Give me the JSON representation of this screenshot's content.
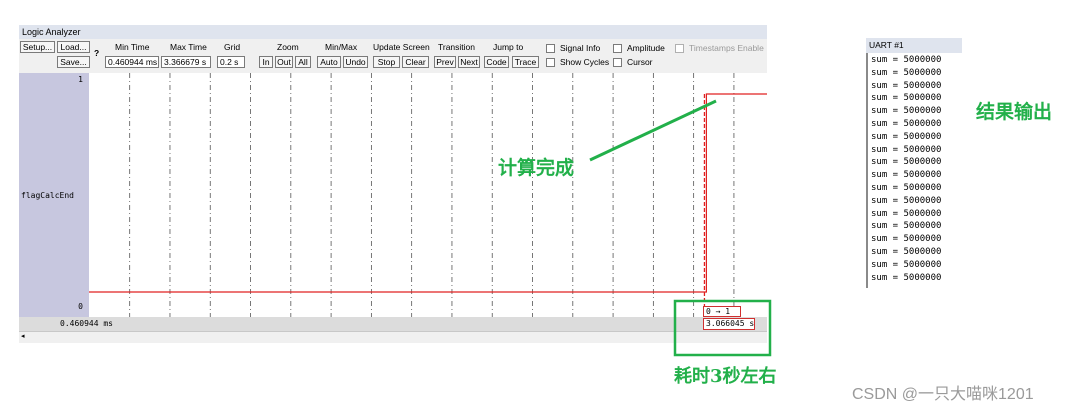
{
  "logic_analyzer": {
    "title": "Logic Analyzer",
    "setup_label": "Setup...",
    "load_label": "Load...",
    "save_label": "Save...",
    "help_label": "?",
    "min_time_label": "Min Time",
    "min_time_value": "0.460944 ms",
    "max_time_label": "Max Time",
    "max_time_value": "3.366679 s",
    "grid_label": "Grid",
    "grid_value": "0.2 s",
    "zoom_label": "Zoom",
    "zoom_in": "In",
    "zoom_out": "Out",
    "zoom_all": "All",
    "minmax_label": "Min/Max",
    "auto_label": "Auto",
    "undo_label": "Undo",
    "update_screen_label": "Update Screen",
    "stop_label": "Stop",
    "clear_label": "Clear",
    "transition_label": "Transition",
    "prev_label": "Prev",
    "next_label": "Next",
    "jump_to_label": "Jump to",
    "code_label": "Code",
    "trace_label": "Trace",
    "signal_info_label": "Signal Info",
    "show_cycles_label": "Show Cycles",
    "amplitude_label": "Amplitude",
    "cursor_label": "Cursor",
    "timestamps_label": "Timestamps Enable",
    "signal_name": "flagCalcEnd",
    "y_high": "1",
    "y_low": "0",
    "status_time": "0.460944 ms",
    "transition_text": "0 → 1",
    "cursor_time": "3.066045 s",
    "colors": {
      "signal": "#e02020",
      "grid": "#555555",
      "panel": "#c7c7df"
    }
  },
  "chart_data": {
    "type": "line",
    "series": [
      {
        "name": "flagCalcEnd",
        "x": [
          0.000460944,
          3.066045,
          3.066045,
          3.366679
        ],
        "values": [
          0,
          0,
          1,
          1
        ]
      }
    ],
    "xlim": [
      0.000460944,
      3.366679
    ],
    "ylim": [
      0,
      1
    ],
    "grid_step": 0.2,
    "grid": true
  },
  "uart": {
    "title": "UART #1",
    "lines": [
      "sum = 5000000",
      "sum = 5000000",
      "sum = 5000000",
      "sum = 5000000",
      "sum = 5000000",
      "sum = 5000000",
      "sum = 5000000",
      "sum = 5000000",
      "sum = 5000000",
      "sum = 5000000",
      "sum = 5000000",
      "sum = 5000000",
      "sum = 5000000",
      "sum = 5000000",
      "sum = 5000000",
      "sum = 5000000",
      "sum = 5000000",
      "sum = 5000000"
    ]
  },
  "annotations": {
    "calc_done": "计算完成",
    "result_output": "结果输出",
    "time_taken": "耗时3秒左右",
    "annotation_color": "#22b04a"
  },
  "watermark": "CSDN @一只大喵咪1201"
}
